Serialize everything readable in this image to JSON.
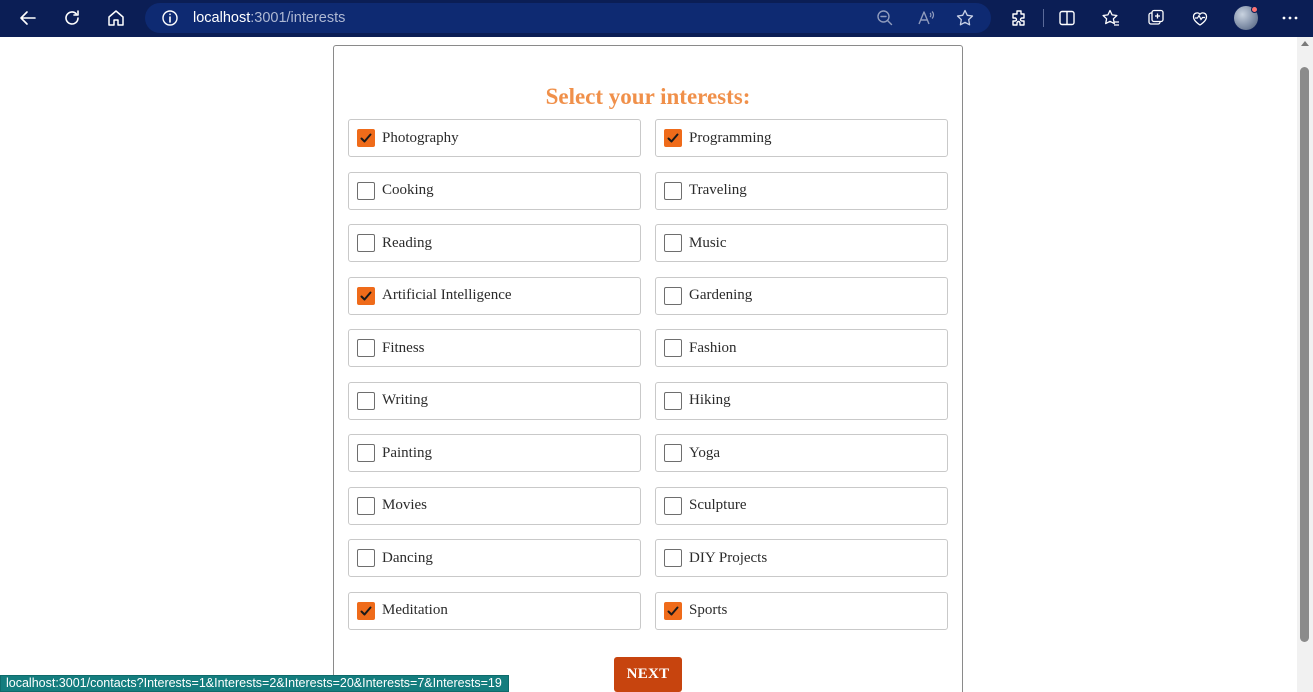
{
  "browser": {
    "url_host": "localhost",
    "url_rest": ":3001/interests",
    "status_url": "localhost:3001/contacts?Interests=1&Interests=2&Interests=20&Interests=7&Interests=19"
  },
  "page": {
    "title": "Select your interests:",
    "next_label": "NEXT",
    "interests": [
      {
        "label": "Photography",
        "checked": true
      },
      {
        "label": "Programming",
        "checked": true
      },
      {
        "label": "Cooking",
        "checked": false
      },
      {
        "label": "Traveling",
        "checked": false
      },
      {
        "label": "Reading",
        "checked": false
      },
      {
        "label": "Music",
        "checked": false
      },
      {
        "label": "Artificial Intelligence",
        "checked": true
      },
      {
        "label": "Gardening",
        "checked": false
      },
      {
        "label": "Fitness",
        "checked": false
      },
      {
        "label": "Fashion",
        "checked": false
      },
      {
        "label": "Writing",
        "checked": false
      },
      {
        "label": "Hiking",
        "checked": false
      },
      {
        "label": "Painting",
        "checked": false
      },
      {
        "label": "Yoga",
        "checked": false
      },
      {
        "label": "Movies",
        "checked": false
      },
      {
        "label": "Sculpture",
        "checked": false
      },
      {
        "label": "Dancing",
        "checked": false
      },
      {
        "label": "DIY Projects",
        "checked": false
      },
      {
        "label": "Meditation",
        "checked": true
      },
      {
        "label": "Sports",
        "checked": true
      }
    ]
  },
  "colors": {
    "title": "#f0904a",
    "checkbox_checked": "#ef6b1a",
    "next_button": "#c7440e",
    "toolbar": "#0b1e55"
  }
}
